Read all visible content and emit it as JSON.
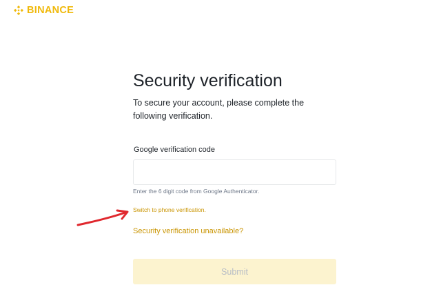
{
  "brand": {
    "logo_icon": "binance-diamond-logo-icon",
    "name": "BINANCE",
    "color": "#F0B90B"
  },
  "page": {
    "title": "Security verification",
    "subtitle": "To secure your account, please complete the following verification."
  },
  "google_verification": {
    "label": "Google verification code",
    "value": "",
    "helper": "Enter the 6 digit code from Google Authenticator."
  },
  "links": {
    "switch_to_phone": "Switch to phone verification.",
    "unavailable": "Security verification unavailable?",
    "color": "#C99400"
  },
  "annotation": {
    "icon": "red-hand-drawn-arrow-icon",
    "color": "#E0282E"
  },
  "submit": {
    "label": "Submit",
    "state": "disabled",
    "background": "#FCF3CF"
  }
}
